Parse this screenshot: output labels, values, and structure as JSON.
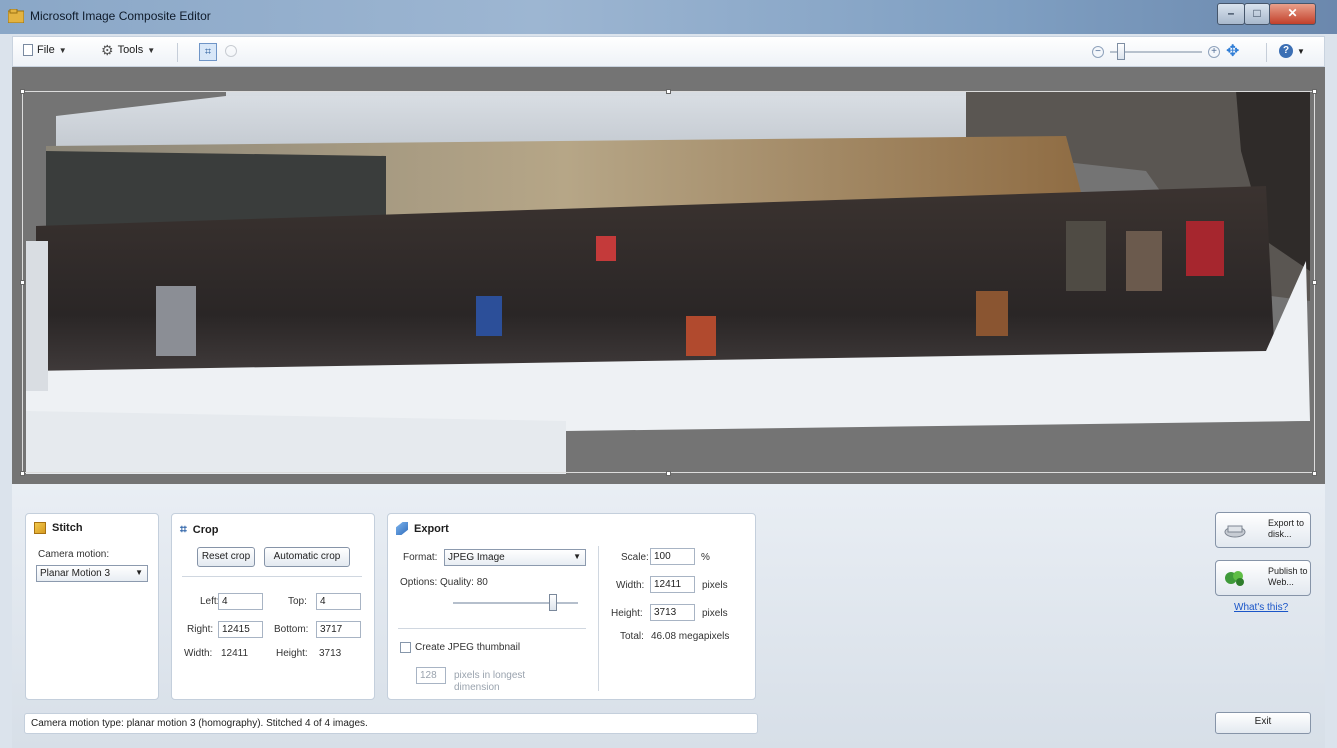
{
  "window": {
    "title": "Microsoft Image Composite Editor",
    "minimize": "–",
    "maximize": "□",
    "close": "✕"
  },
  "toolbar": {
    "file_label": "File",
    "tools_label": "Tools",
    "crop_tool_icon": "crop-icon",
    "zoom_minus": "−",
    "zoom_plus": "+",
    "zoom_level": 0.12,
    "help_label": "?"
  },
  "panels": {
    "stitch": {
      "title": "Stitch",
      "camera_motion_label": "Camera motion:",
      "camera_motion_value": "Planar Motion 3"
    },
    "crop": {
      "title": "Crop",
      "reset_label": "Reset crop",
      "auto_label": "Automatic crop",
      "left_label": "Left:",
      "left_value": "4",
      "top_label": "Top:",
      "top_value": "4",
      "right_label": "Right:",
      "right_value": "12415",
      "bottom_label": "Bottom:",
      "bottom_value": "3717",
      "width_label": "Width:",
      "width_value": "12411",
      "height_label": "Height:",
      "height_value": "3713"
    },
    "export": {
      "title": "Export",
      "format_label": "Format:",
      "format_value": "JPEG Image",
      "options_label": "Options: Quality: 80",
      "quality_level": 0.8,
      "thumbnail_label": "Create JPEG thumbnail",
      "thumbnail_size": "128",
      "thumbnail_unit": "pixels in longest dimension",
      "scale_label": "Scale:",
      "scale_value": "100",
      "scale_unit": "%",
      "width_label": "Width:",
      "width_value": "12411",
      "width_unit": "pixels",
      "height_label": "Height:",
      "height_value": "3713",
      "height_unit": "pixels",
      "total_label": "Total:",
      "total_value": "46.08 megapixels"
    }
  },
  "actions": {
    "export_disk": "Export to disk...",
    "publish_web": "Publish to Web...",
    "whats_this": "What's this?",
    "exit": "Exit"
  },
  "status_text": "Camera motion type: planar motion 3 (homography). Stitched 4 of 4 images.",
  "colors": {
    "canvas_bg": "#747474",
    "panel_border": "#c4cfdc",
    "link": "#1a55c8"
  }
}
